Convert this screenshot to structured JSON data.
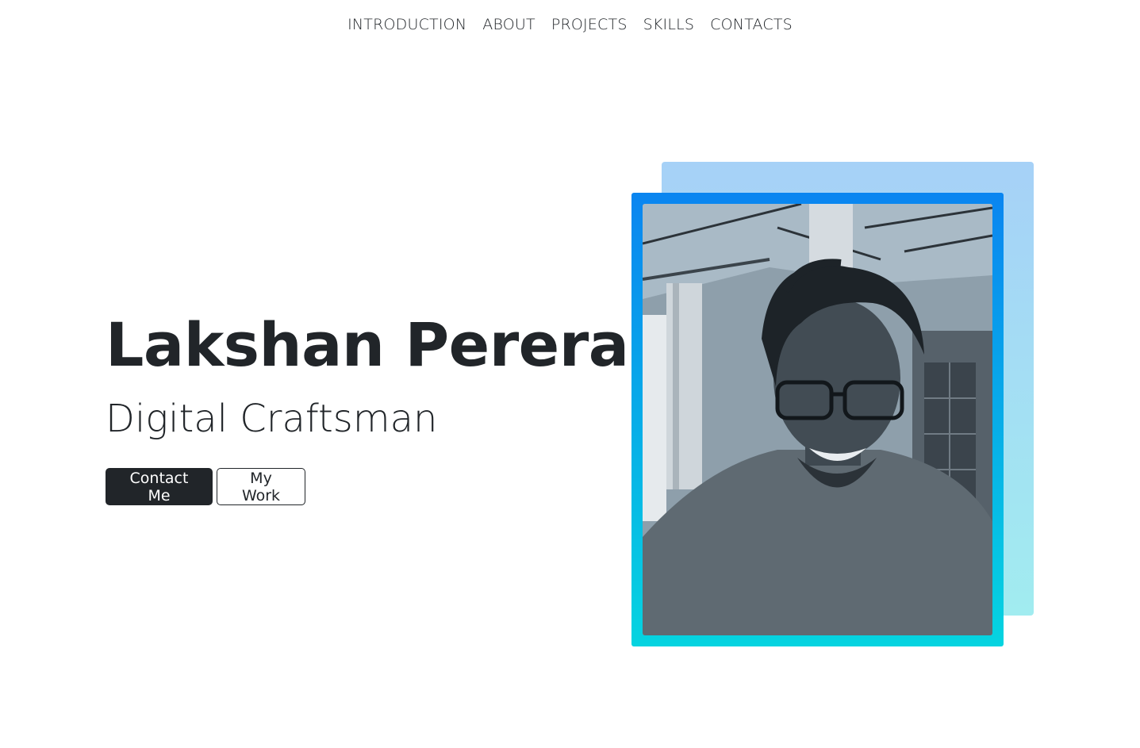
{
  "nav": {
    "items": [
      {
        "label": "INTRODUCTION"
      },
      {
        "label": "ABOUT"
      },
      {
        "label": "PROJECTS"
      },
      {
        "label": "SKILLS"
      },
      {
        "label": "CONTACTS"
      }
    ]
  },
  "hero": {
    "name": "Lakshan Perera",
    "title": "Digital Craftsman",
    "contact_button": "Contact Me",
    "work_button": "My Work"
  },
  "colors": {
    "text": "#212529",
    "frame_top": "#0a85f0",
    "frame_bottom": "#05d4e0",
    "back_panel_top": "#a6d1f7",
    "back_panel_bottom": "#a1ecf0"
  },
  "image": {
    "subject": "portrait-photo"
  }
}
